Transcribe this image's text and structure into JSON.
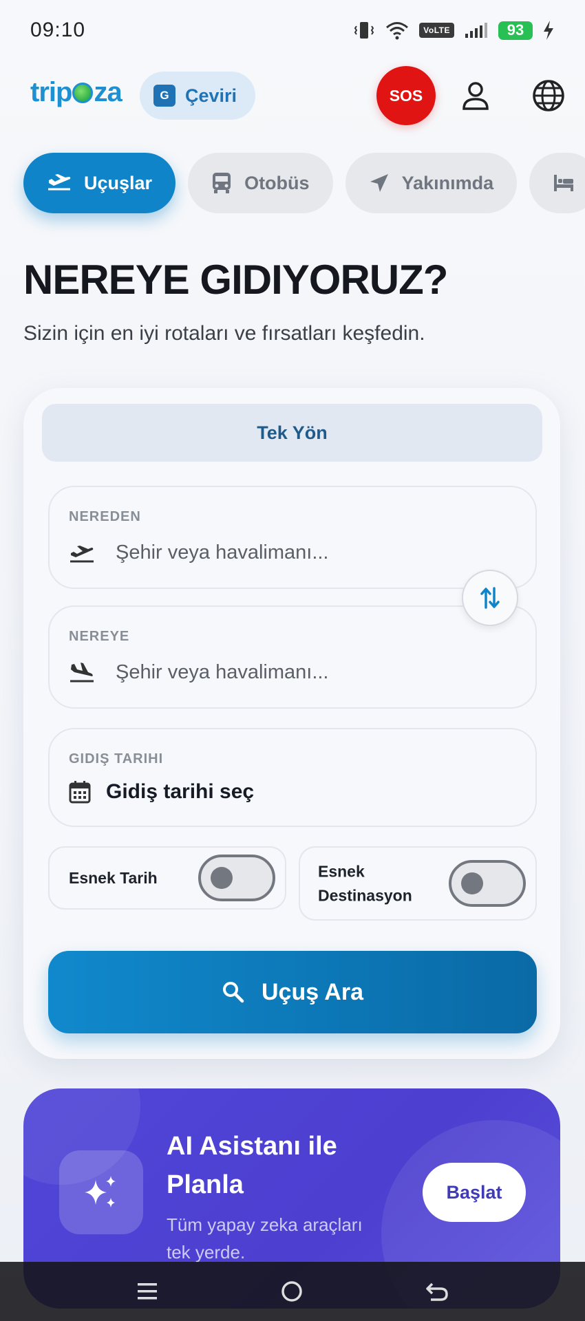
{
  "status_bar": {
    "time": "09:10",
    "volte": "VoLTE",
    "battery": "93"
  },
  "header": {
    "logo_prefix": "trip",
    "logo_suffix": "za",
    "translate_label": "Çeviri",
    "sos_label": "SOS"
  },
  "tabs": [
    {
      "label": "Uçuşlar",
      "icon": "plane-icon",
      "active": true
    },
    {
      "label": "Otobüs",
      "icon": "bus-icon",
      "active": false
    },
    {
      "label": "Yakınımda",
      "icon": "navigation-icon",
      "active": false
    },
    {
      "label": "",
      "icon": "hotel-bed-icon",
      "active": false
    }
  ],
  "hero": {
    "title": "NEREYE GIDIYORUZ?",
    "subtitle": "Sizin için en iyi rotaları ve fırsatları keşfedin."
  },
  "search": {
    "trip_type": "Tek Yön",
    "from_label": "NEREDEN",
    "from_placeholder": "Şehir veya havalimanı...",
    "to_label": "NEREYE",
    "to_placeholder": "Şehir veya havalimanı...",
    "date_label": "GIDIŞ TARIHI",
    "date_value": "Gidiş tarihi seç",
    "flexible_date_label": "Esnek Tarih",
    "flexible_date_on": false,
    "flexible_destination_label_line1": "Esnek",
    "flexible_destination_label_line2": "Destinasyon",
    "flexible_destination_on": false,
    "search_button": "Uçuş Ara"
  },
  "ai_banner": {
    "title_line1": "AI Asistanı ile",
    "title_line2": "Planla",
    "description_line1": "Tüm yapay zeka araçları",
    "description_line2": "tek yerde.",
    "button": "Başlat"
  },
  "colors": {
    "primary": "#1084c9",
    "sos": "#e11414",
    "ai_banner": "#4d3fd0",
    "battery": "#28c054"
  }
}
